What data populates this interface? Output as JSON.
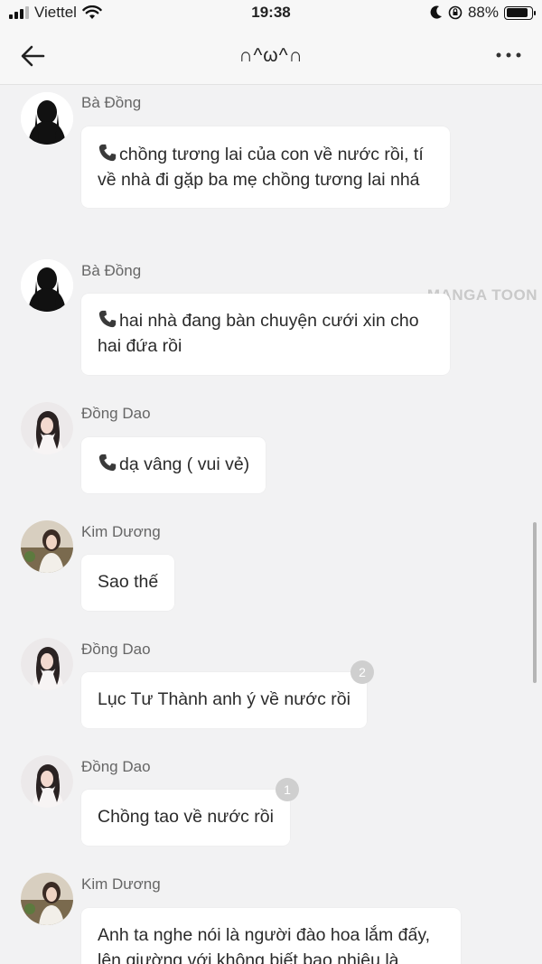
{
  "status_bar": {
    "carrier": "Viettel",
    "time": "19:38",
    "battery_percent": "88%",
    "battery_level": 0.88
  },
  "header": {
    "title": "∩^ω^∩"
  },
  "watermark": "MANGA TOON",
  "messages": [
    {
      "sender": "Bà Đồng",
      "text": "chồng tương lai của con về nước rồi, tí về nhà đi gặp ba mẹ chồng tương lai nhá",
      "line1": "chồng tương lai của con về nước rồi, tí",
      "line2": "về nhà đi gặp ba mẹ chồng tương lai nhá",
      "icon": "phone-icon"
    },
    {
      "sender": "Bà Đồng",
      "text": "hai nhà đang bàn chuyện cưới xin cho hai đứa rồi",
      "line1": "hai nhà đang bàn chuyện cưới xin cho",
      "line2": "hai đứa rồi",
      "icon": "phone-icon"
    },
    {
      "sender": "Đồng Dao",
      "text": "dạ vâng ( vui vẻ)",
      "icon": "phone-icon"
    },
    {
      "sender": "Kim Dương",
      "text": "Sao thế"
    },
    {
      "sender": "Đồng Dao",
      "text": "Lục Tư Thành anh ý về nước rồi",
      "badge": "2"
    },
    {
      "sender": "Đồng Dao",
      "text": "Chồng tao về nước rồi",
      "badge": "1"
    },
    {
      "sender": "Kim Dương",
      "line1": "Anh ta nghe nói là người đào hoa lắm đấy,",
      "line2": "lên giường với không biết bao nhiêu là"
    }
  ],
  "colors": {
    "background": "#f2f2f3",
    "bubble": "#ffffff",
    "badge": "#cfcfcf"
  }
}
